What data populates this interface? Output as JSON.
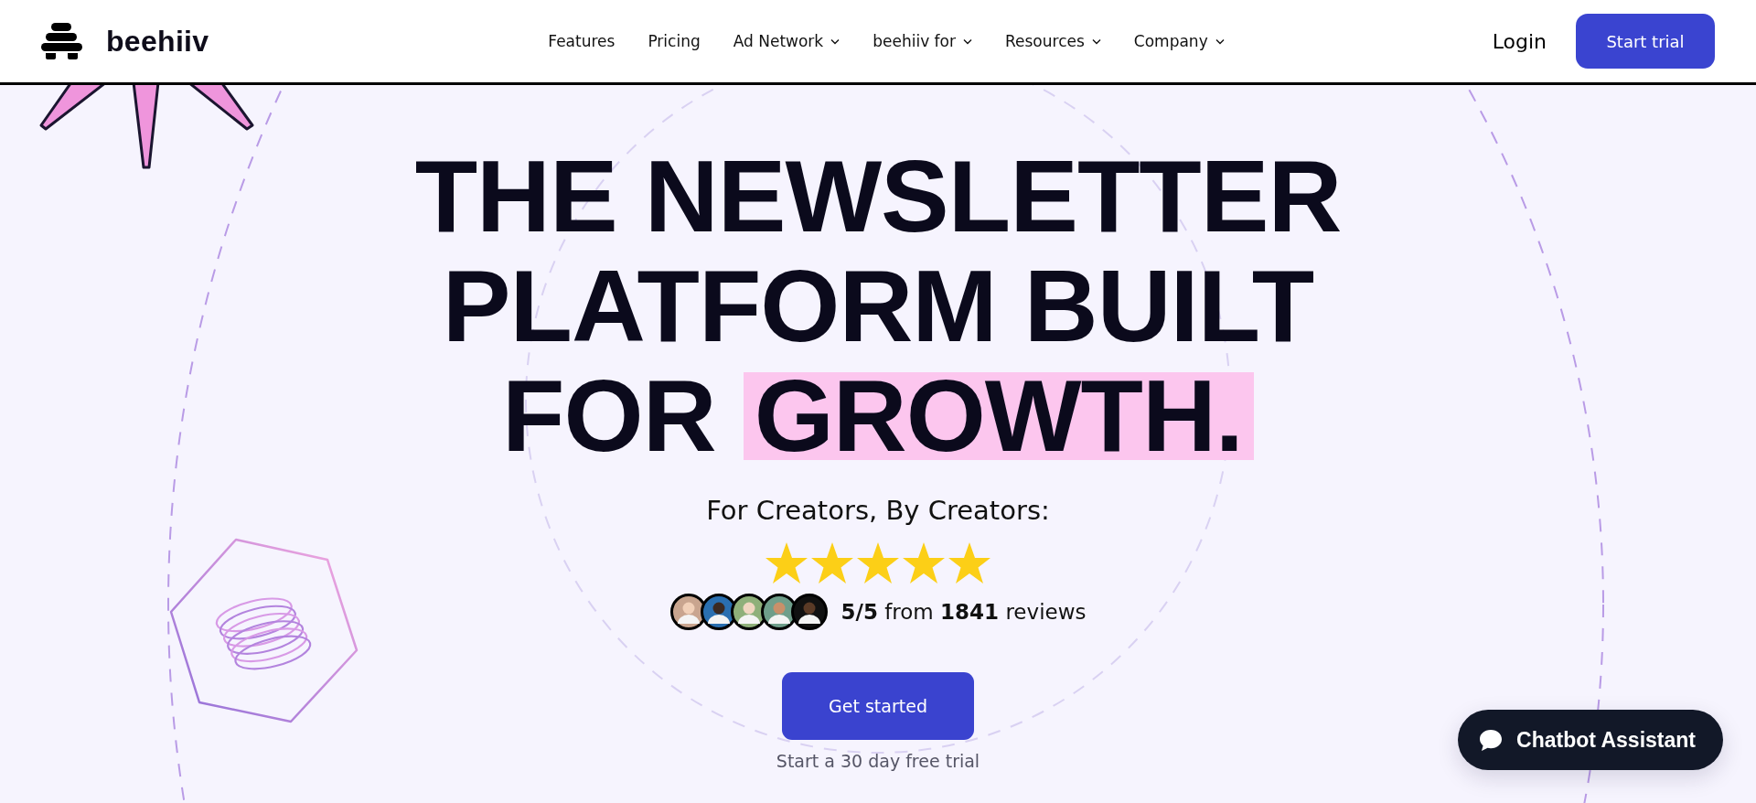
{
  "header": {
    "logo": {
      "text": "beehiiv"
    },
    "nav": [
      {
        "label": "Features",
        "dropdown": false
      },
      {
        "label": "Pricing",
        "dropdown": false
      },
      {
        "label": "Ad Network",
        "dropdown": true
      },
      {
        "label": "beehiiv for",
        "dropdown": true
      },
      {
        "label": "Resources",
        "dropdown": true
      },
      {
        "label": "Company",
        "dropdown": true
      }
    ],
    "login": "Login",
    "cta": "Start trial"
  },
  "hero": {
    "headline": [
      [
        {
          "text": "THE NEWSLETTER",
          "highlighted": false
        }
      ],
      [
        {
          "text": "PLATFORM BUILT",
          "highlighted": false
        }
      ],
      [
        {
          "text": "FOR ",
          "highlighted": false
        },
        {
          "text": "GROWTH.",
          "highlighted": true
        }
      ]
    ],
    "tagline": "For Creators, By Creators:",
    "rating": {
      "stars": 5,
      "avatars": [
        {
          "kind": "picture"
        },
        {
          "kind": "picture"
        },
        {
          "kind": "picture"
        },
        {
          "kind": "picture"
        },
        {
          "kind": "picture"
        }
      ],
      "text": "**5/5** from **1841** reviews"
    },
    "cta": "Get started",
    "note": "Start a 30 day free trial"
  },
  "chat_button": {
    "label": "Chatbot Assistant"
  }
}
